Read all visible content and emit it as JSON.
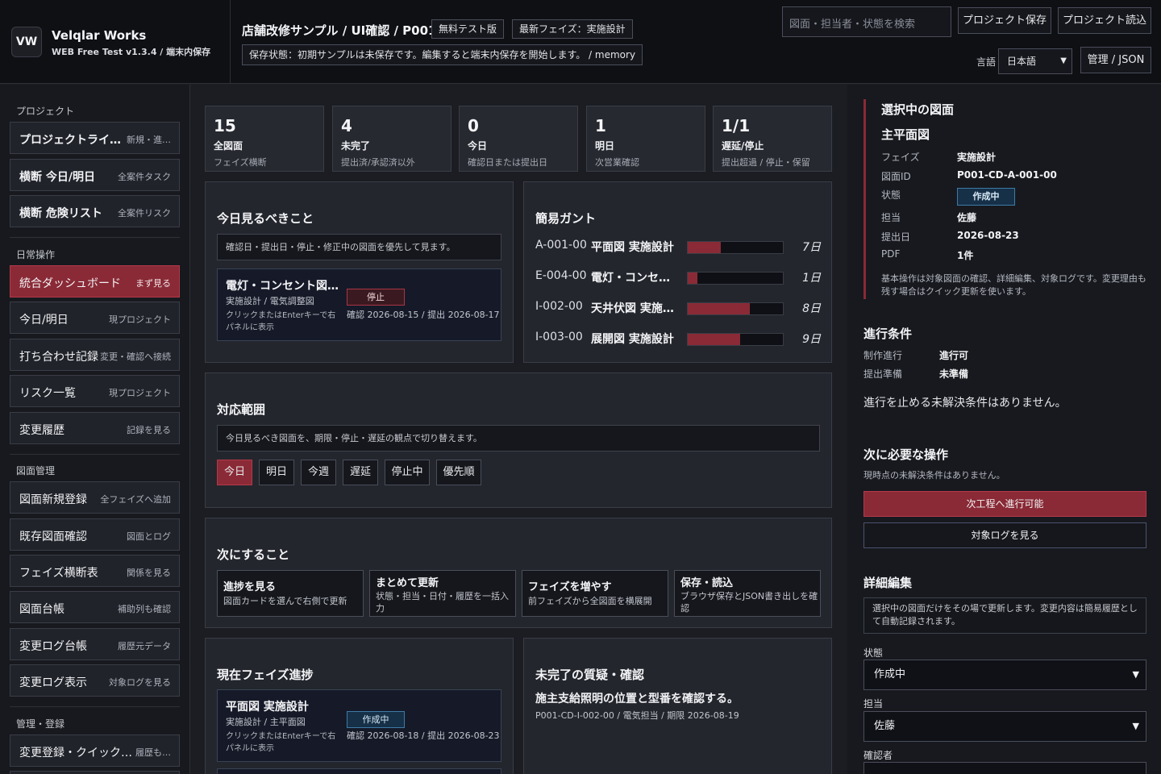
{
  "header": {
    "brand_logo": "VW",
    "brand_name": "Velqlar Works",
    "brand_sub": "WEB Free Test v1.3.4 / 端末内保存",
    "project_title": "店舗改修サンプル / UI確認 / P001",
    "tag_free": "無料テスト版",
    "tag_phase": "最新フェイズ：実施設計",
    "save_status": "保存状態：初期サンプルは未保存です。編集すると端末内保存を開始します。 / memory",
    "search_placeholder": "図面・担当者・状態を検索",
    "btn_save": "プロジェクト保存",
    "btn_load": "プロジェクト読込",
    "lang_label": "言語",
    "lang_value": "日本語",
    "btn_admin": "管理 / JSON"
  },
  "sidebar": {
    "sec_project": "プロジェクト",
    "sec_daily": "日常操作",
    "sec_drawing": "図面管理",
    "sec_admin": "管理・登録",
    "project_items": [
      {
        "label": "プロジェクトライ…",
        "sub": "新規・進…"
      },
      {
        "label": "横断 今日/明日",
        "sub": "全案件タスク"
      },
      {
        "label": "横断 危険リスト",
        "sub": "全案件リスク"
      }
    ],
    "daily_items": [
      {
        "label": "統合ダッシュボード",
        "sub": "まず見る"
      },
      {
        "label": "今日/明日",
        "sub": "現プロジェクト"
      },
      {
        "label": "打ち合わせ記録",
        "sub": "変更・確認へ接続"
      },
      {
        "label": "リスク一覧",
        "sub": "現プロジェクト"
      },
      {
        "label": "変更履歴",
        "sub": "記録を見る"
      }
    ],
    "drawing_items": [
      {
        "label": "図面新規登録",
        "sub": "全フェイズへ追加"
      },
      {
        "label": "既存図面確認",
        "sub": "図面とログ"
      },
      {
        "label": "フェイズ横断表",
        "sub": "関係を見る"
      },
      {
        "label": "図面台帳",
        "sub": "補助列も確認"
      },
      {
        "label": "変更ログ台帳",
        "sub": "履歴元データ"
      },
      {
        "label": "変更ログ表示",
        "sub": "対象ログを見る"
      }
    ],
    "admin_items": [
      {
        "label": "変更登録・クイック…",
        "sub": "履歴も…"
      }
    ]
  },
  "stats": [
    {
      "value": "15",
      "label": "全図面",
      "desc": "フェイズ横断"
    },
    {
      "value": "4",
      "label": "未完了",
      "desc": "提出済/承認済以外"
    },
    {
      "value": "0",
      "label": "今日",
      "desc": "確認日または提出日"
    },
    {
      "value": "1",
      "label": "明日",
      "desc": "次営業確認"
    },
    {
      "value": "1/1",
      "label": "遅延/停止",
      "desc": "提出超過 / 停止・保留"
    }
  ],
  "today": {
    "title": "今日見るべきこと",
    "note": "確認日・提出日・停止・修正中の図面を優先して見ます。",
    "card": {
      "title": "電灯・コンセント図…",
      "sub": "実施設計 / 電気調整図",
      "hint": "クリックまたはEnterキーで右パネルに表示",
      "badge": "停止",
      "dates": "確認 2026-08-15 / 提出 2026-08-17"
    }
  },
  "gantt": {
    "title": "簡易ガント",
    "rows": [
      {
        "id": "A-001-00",
        "name": "平面図 実施設計",
        "progress": 0.35,
        "days": "7日"
      },
      {
        "id": "E-004-00",
        "name": "電灯・コンセ…",
        "progress": 0.1,
        "days": "1日"
      },
      {
        "id": "I-002-00",
        "name": "天井伏図 実施…",
        "progress": 0.65,
        "days": "8日"
      },
      {
        "id": "I-003-00",
        "name": "展開図 実施設計",
        "progress": 0.55,
        "days": "9日"
      }
    ]
  },
  "scope": {
    "title": "対応範囲",
    "note": "今日見るべき図面を、期限・停止・遅延の観点で切り替えます。",
    "filters": [
      "今日",
      "明日",
      "今週",
      "遅延",
      "停止中",
      "優先順"
    ],
    "active_filter": "今日"
  },
  "next": {
    "title": "次にすること",
    "cards": [
      {
        "title": "進捗を見る",
        "desc": "図面カードを選んで右側で更新"
      },
      {
        "title": "まとめて更新",
        "desc": "状態・担当・日付・履歴を一括入力"
      },
      {
        "title": "フェイズを増やす",
        "desc": "前フェイズから全図面を横展開"
      },
      {
        "title": "保存・読込",
        "desc": "ブラウザ保存とJSON書き出しを確認"
      }
    ]
  },
  "current_phase": {
    "title": "現在フェイズ進捗",
    "card": {
      "title": "平面図 実施設計",
      "sub": "実施設計 / 主平面図",
      "hint": "クリックまたはEnterキーで右パネルに表示",
      "badge": "作成中",
      "dates": "確認 2026-08-18 / 提出 2026-08-23"
    }
  },
  "questions": {
    "title": "未完了の質疑・確認",
    "item_title": "施主支給照明の位置と型番を確認する。",
    "item_meta": "P001-CD-I-002-00 / 電気担当 / 期限 2026-08-19"
  },
  "detail": {
    "heading": "選択中の図面",
    "drawing_name": "主平面図",
    "fields": [
      {
        "label": "フェイズ",
        "value": "実施設計"
      },
      {
        "label": "図面ID",
        "value": "P001-CD-A-001-00"
      },
      {
        "label": "状態",
        "value": "作成中"
      },
      {
        "label": "担当",
        "value": "佐藤"
      },
      {
        "label": "提出日",
        "value": "2026-08-23"
      },
      {
        "label": "PDF",
        "value": "1件"
      }
    ],
    "info": "基本操作は対象図面の確認、詳細編集、対象ログです。変更理由も残す場合はクイック更新を使います。",
    "cond_title": "進行条件",
    "conds": [
      {
        "label": "制作進行",
        "value": "進行可"
      },
      {
        "label": "提出準備",
        "value": "未準備"
      }
    ],
    "cond_msg": "進行を止める未解決条件はありません。",
    "ops_title": "次に必要な操作",
    "ops_msg": "現時点の未解決条件はありません。",
    "btn_next": "次工程へ進行可能",
    "btn_log": "対象ログを見る",
    "edit_title": "詳細編集",
    "edit_note": "選択中の図面だけをその場で更新します。変更内容は簡易履歴として自動記録されます。",
    "status_label": "状態",
    "status_value": "作成中",
    "owner_label": "担当",
    "owner_value": "佐藤",
    "checker_label": "確認者"
  }
}
